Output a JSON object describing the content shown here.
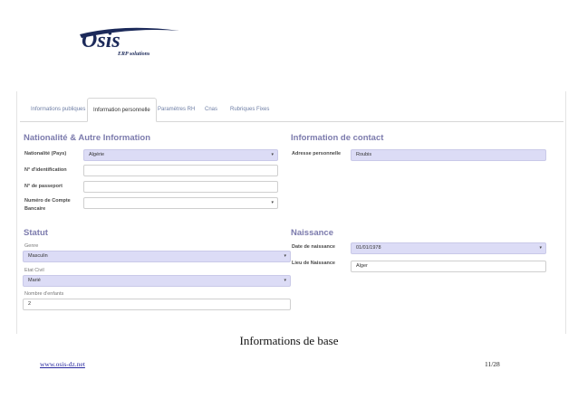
{
  "logo": {
    "name": "Osis",
    "tagline": "ERP solutions"
  },
  "tabs": [
    {
      "label": "Informations publiques",
      "active": false
    },
    {
      "label": "Information personnelle",
      "active": true
    },
    {
      "label": "Paramètres RH",
      "active": false
    },
    {
      "label": "Cnas",
      "active": false
    },
    {
      "label": "Rubriques Fixes",
      "active": false
    }
  ],
  "nationalite": {
    "title": "Nationalité & Autre Information",
    "nationalite_label": "Nationalité (Pays)",
    "nationalite_value": "Algérie",
    "identification_label": "N° d'identification",
    "identification_value": "",
    "passeport_label": "N° de passeport",
    "passeport_value": "",
    "compte_label": "Numéro de Compte Bancaire",
    "compte_value": ""
  },
  "contact": {
    "title": "Information de contact",
    "adresse_label": "Adresse personnelle",
    "adresse_value": "Roubis"
  },
  "statut": {
    "title": "Statut",
    "genre_label": "Genre",
    "genre_value": "Masculin",
    "etat_label": "Etat Civil",
    "etat_value": "Marié",
    "enfants_label": "Nombre d'enfants",
    "enfants_value": "2"
  },
  "naissance": {
    "title": "Naissance",
    "date_label": "Date de naissance",
    "date_value": "01/01/1978",
    "lieu_label": "Lieu de Naissance",
    "lieu_value": "Alger"
  },
  "caption": "Informations de base",
  "footer": {
    "link": "www.osis-dz.net",
    "page": "11/28"
  },
  "colors": {
    "accent": "#7c7bad",
    "field_fill": "#dcdcf6",
    "logo_navy": "#1c2a5a"
  }
}
